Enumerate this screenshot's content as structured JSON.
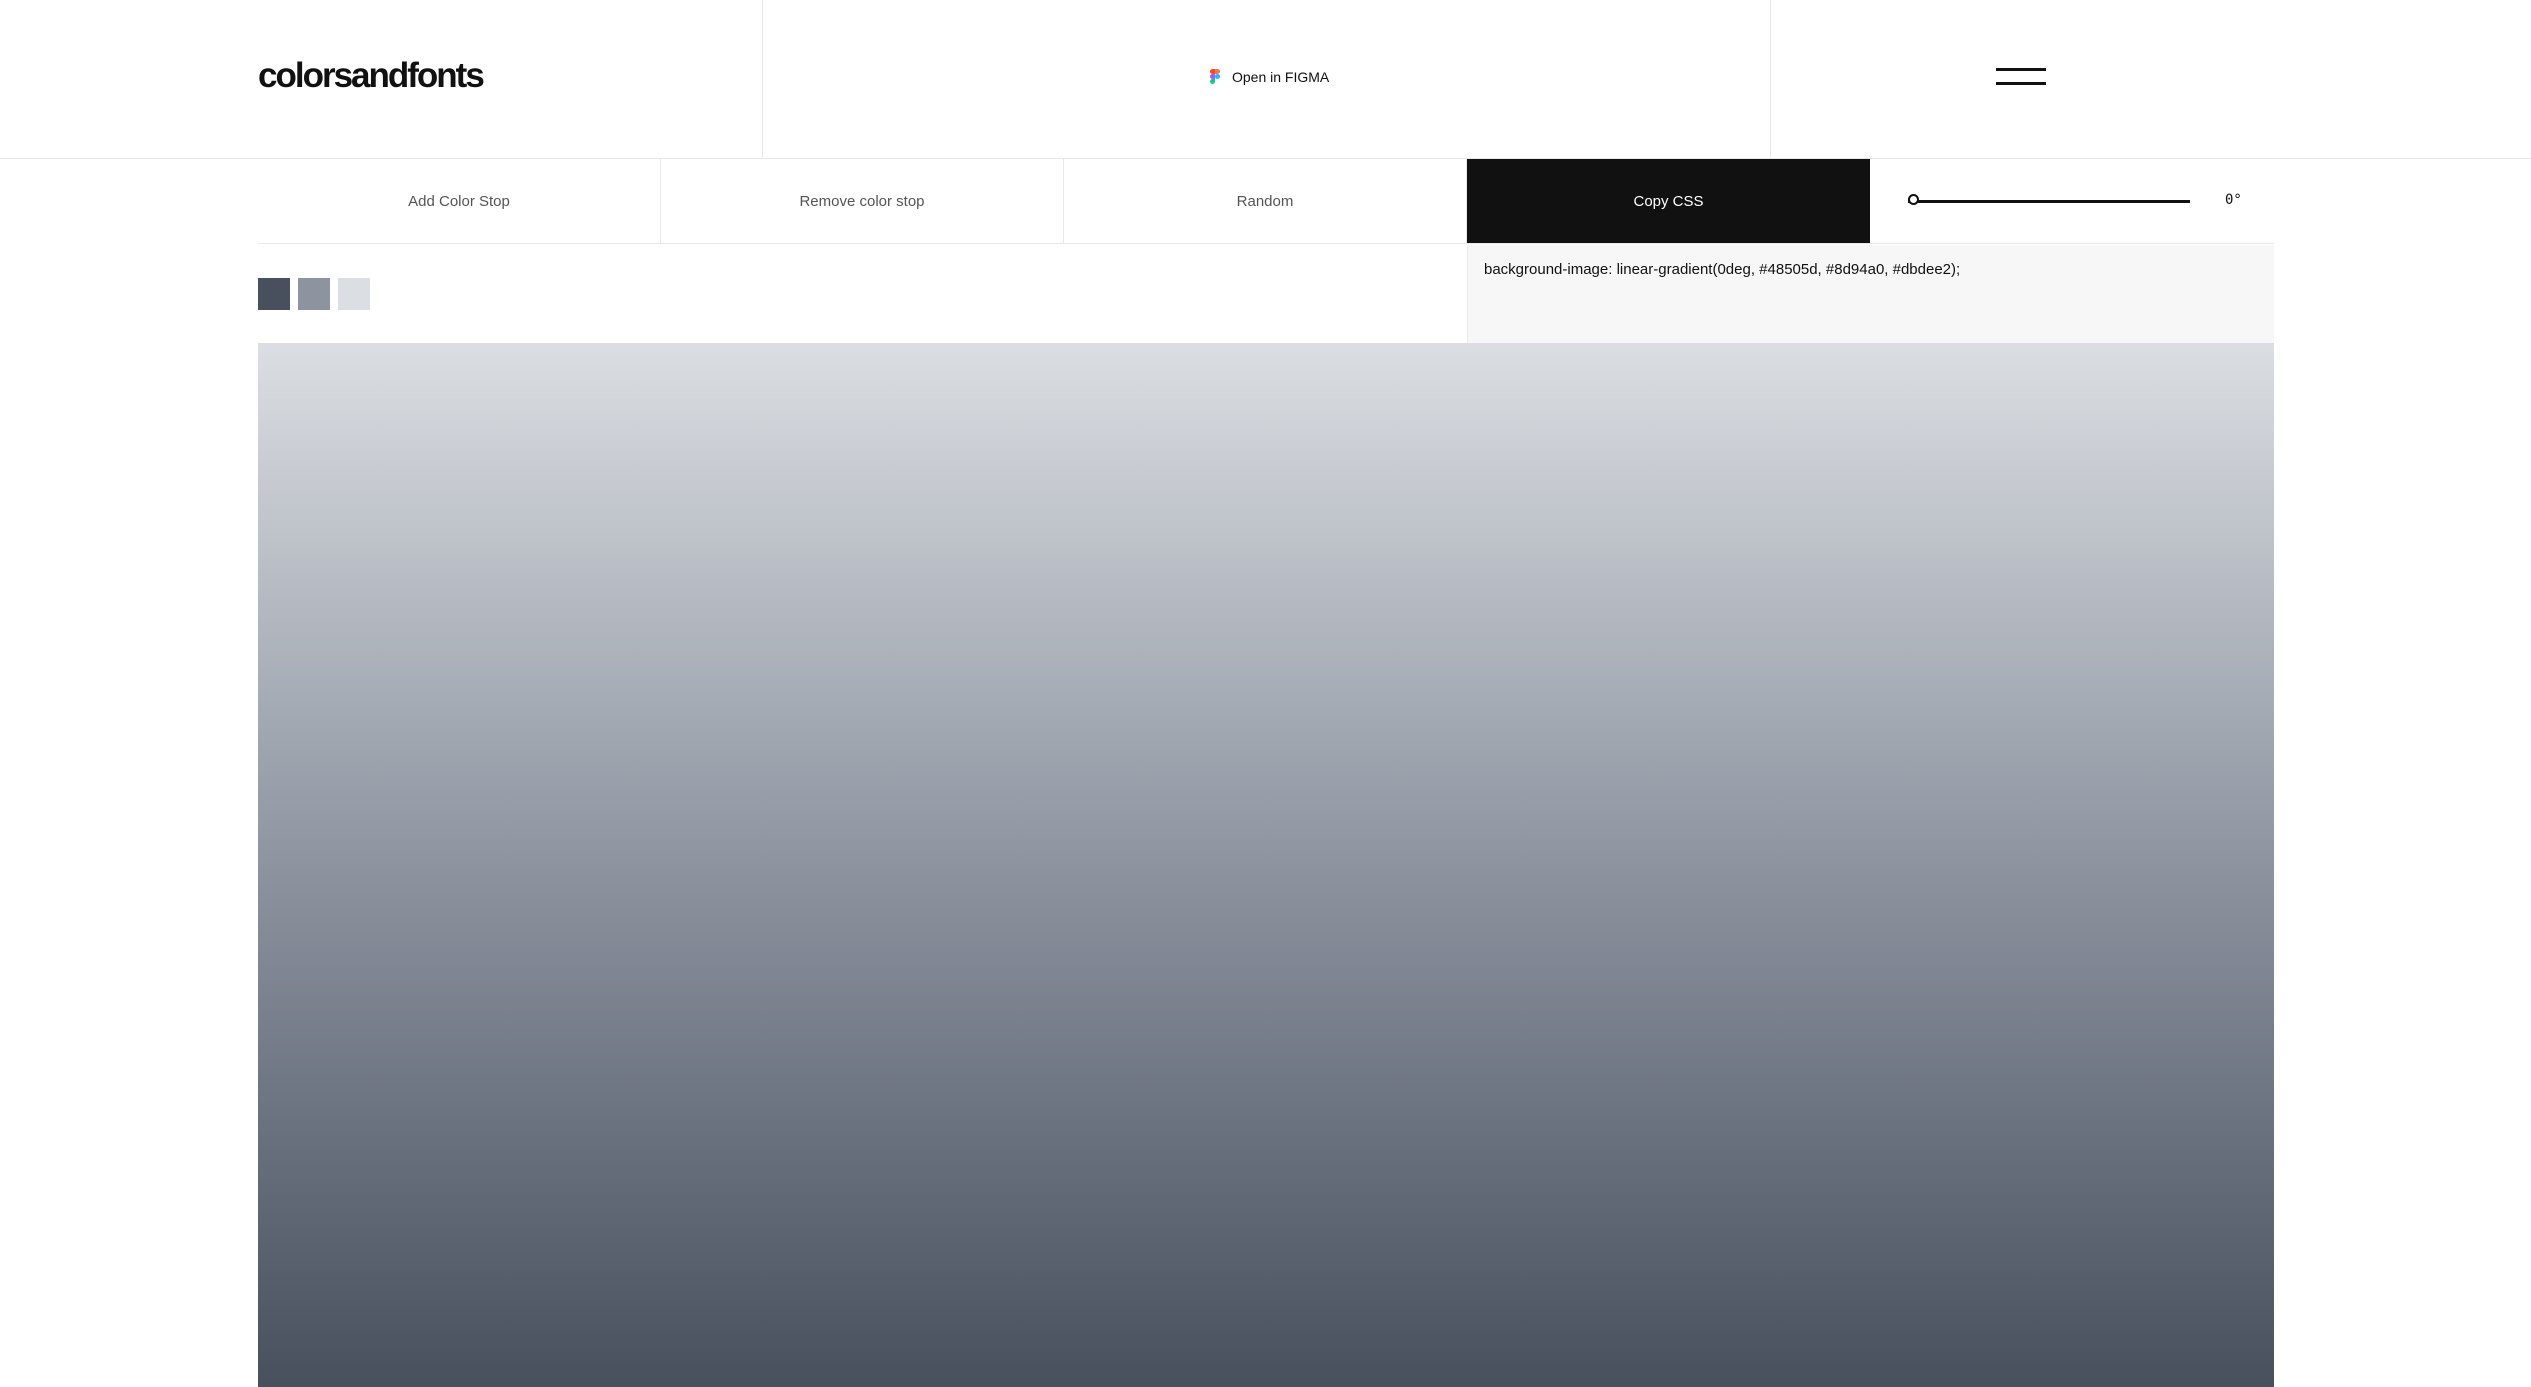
{
  "brand": {
    "logo": "colorsandfonts"
  },
  "header": {
    "figma_label": "Open in FIGMA",
    "figma_icon": "figma-icon",
    "menu_icon": "hamburger-menu-icon"
  },
  "toolbar": {
    "add": "Add Color Stop",
    "remove": "Remove color stop",
    "random": "Random",
    "copy": "Copy CSS",
    "angle_value": "0°",
    "angle_fraction": 0
  },
  "gradient": {
    "angle_deg": 0,
    "stops": [
      "#48505d",
      "#8d94a0",
      "#dbdee2"
    ],
    "css": "background-image: linear-gradient(0deg, #48505d, #8d94a0, #dbdee2);"
  },
  "colors": {
    "accent": "#111111",
    "border": "#e8e8e8",
    "code_bg": "#f7f7f7"
  }
}
